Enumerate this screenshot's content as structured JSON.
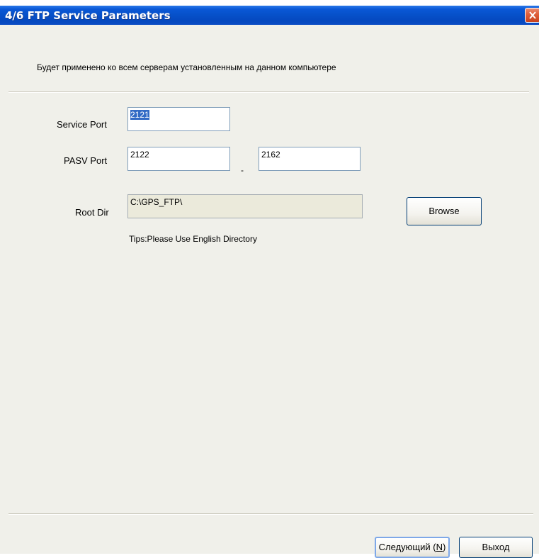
{
  "window": {
    "title": "4/6 FTP Service Parameters"
  },
  "notice": "Будет применено ко всем серверам установленным на данном компьютере",
  "form": {
    "service_port_label": "Service Port",
    "service_port_value": "2121",
    "pasv_port_label": "PASV Port",
    "pasv_port_start": "2122",
    "pasv_separator": "-",
    "pasv_port_end": "2162",
    "root_dir_label": "Root Dir",
    "root_dir_value": "C:\\GPS_FTP\\",
    "browse_label": "Browse",
    "tips": "Tips:Please Use English Directory"
  },
  "footer": {
    "next_label": "Следующий (",
    "next_mnemonic": "N",
    "next_suffix": ")",
    "exit_label": "Выход"
  },
  "colors": {
    "titlebar": "#0a58d6",
    "selection": "#316ac5",
    "close": "#e0603c"
  },
  "icons": {
    "close": "close-x-icon"
  }
}
